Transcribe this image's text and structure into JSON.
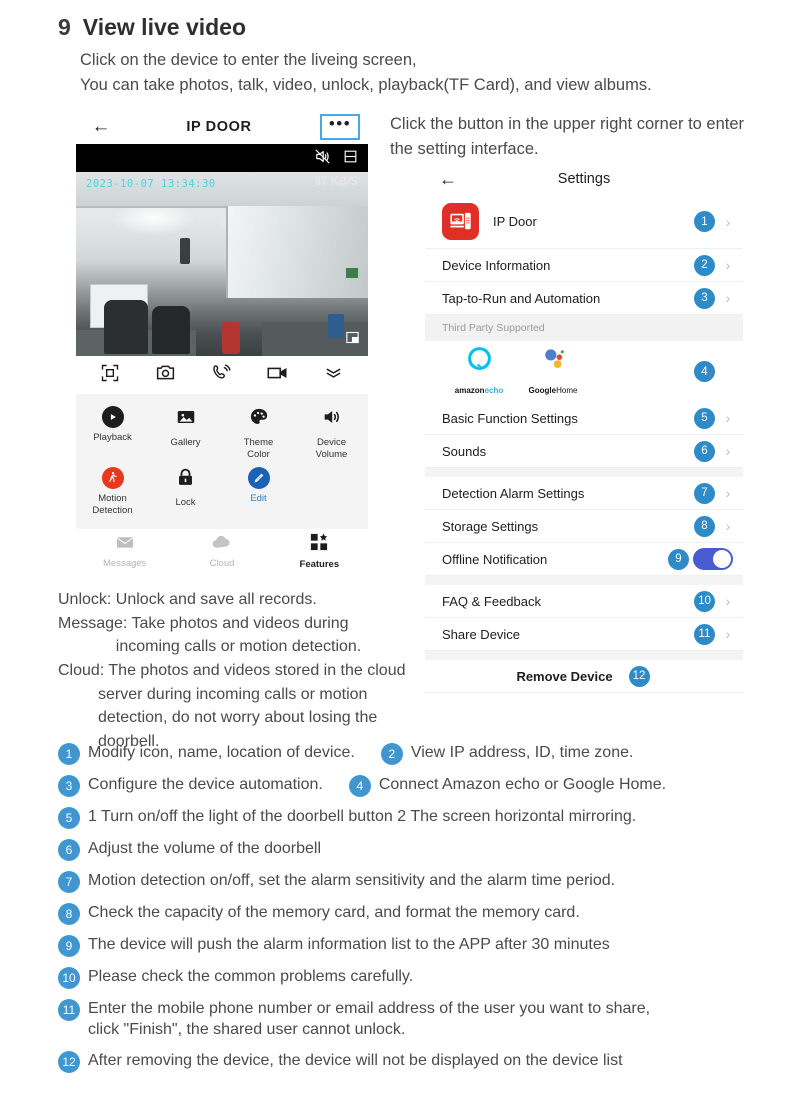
{
  "section": {
    "number": "9",
    "title": "View live video"
  },
  "intro": {
    "line1": "Click on the device to enter the liveing screen,",
    "line2": "You can take photos, talk, video, unlock, playback(TF Card), and view albums."
  },
  "right_note": "Click the button in the upper right corner to enter the setting interface.",
  "phone": {
    "header": {
      "back": "←",
      "title": "IP DOOR",
      "more": "•••"
    },
    "video": {
      "timestamp": "2023-10-07 13:34:30",
      "speed": "37 KB/S"
    },
    "controls": [
      {
        "name": "unlock-icon"
      },
      {
        "name": "photo-icon"
      },
      {
        "name": "talk-icon"
      },
      {
        "name": "record-icon"
      },
      {
        "name": "collapse-icon"
      }
    ],
    "features": [
      {
        "label": "Playback",
        "icon": "play-icon",
        "style": "dark"
      },
      {
        "label": "Gallery",
        "icon": "gallery-icon",
        "style": "plain"
      },
      {
        "label": "Theme\nColor",
        "icon": "palette-icon",
        "style": "plain"
      },
      {
        "label": "Device\nVolume",
        "icon": "volume-icon",
        "style": "plain"
      },
      {
        "label": "Motion\nDetection",
        "icon": "motion-icon",
        "style": "red"
      },
      {
        "label": "Lock",
        "icon": "lock-icon",
        "style": "plain"
      },
      {
        "label": "Edit",
        "icon": "edit-icon",
        "style": "blue"
      }
    ],
    "tabs": [
      {
        "label": "Messages",
        "icon": "mail-icon",
        "active": false
      },
      {
        "label": "Cloud",
        "icon": "cloud-icon",
        "active": false
      },
      {
        "label": "Features",
        "icon": "grid-icon",
        "active": true
      }
    ]
  },
  "settings": {
    "header": {
      "back": "←",
      "title": "Settings"
    },
    "device": {
      "name": "IP Door",
      "badge": "1"
    },
    "rows": [
      {
        "label": "Device Information",
        "badge": "2",
        "chevron": true
      },
      {
        "label": "Tap-to-Run and Automation",
        "badge": "3",
        "chevron": true
      }
    ],
    "third_party": {
      "header": "Third Party Supported",
      "badge": "4",
      "brands": [
        {
          "name_a": "amazon",
          "name_b": "echo",
          "icon": "amazon-echo-icon"
        },
        {
          "name_a": "Google",
          "name_b": "Home",
          "icon": "google-home-icon"
        }
      ]
    },
    "rows2": [
      {
        "label": "Basic Function Settings",
        "badge": "5",
        "chevron": true
      },
      {
        "label": "Sounds",
        "badge": "6",
        "chevron": true
      },
      {
        "label": "Detection Alarm Settings",
        "badge": "7",
        "chevron": true
      },
      {
        "label": "Storage Settings",
        "badge": "8",
        "chevron": true
      }
    ],
    "offline": {
      "label": "Offline Notification",
      "badge": "9",
      "toggle_on": true
    },
    "rows3": [
      {
        "label": "FAQ & Feedback",
        "badge": "10",
        "chevron": true
      },
      {
        "label": "Share Device",
        "badge": "11",
        "chevron": true
      }
    ],
    "remove": {
      "label": "Remove Device",
      "badge": "12"
    }
  },
  "description": "Unlock: Unlock and save all records.\nMessage: Take photos and videos during\n             incoming calls or motion detection.\nCloud: The photos and videos stored in the cloud\n         server during incoming calls or motion\n         detection, do not worry about losing the\n         doorbell.",
  "legend": [
    {
      "num": "1",
      "text": "Modify icon, name, location of device.",
      "num2": "2",
      "text2": "View IP address, ID, time zone."
    },
    {
      "num": "3",
      "text": "Configure the device automation.",
      "num2": "4",
      "text2": "Connect Amazon echo or Google Home."
    },
    {
      "num": "5",
      "text": "1  Turn on/off the light of the doorbell button  2  The screen horizontal mirroring."
    },
    {
      "num": "6",
      "text": "Adjust the volume of the doorbell"
    },
    {
      "num": "7",
      "text": "Motion detection on/off, set the alarm sensitivity and the alarm time period."
    },
    {
      "num": "8",
      "text": "Check the capacity of the memory card, and format the memory card."
    },
    {
      "num": "9",
      "text": "The device will push the alarm information list to the APP after 30 minutes"
    },
    {
      "num": "10",
      "text": "Please check the common problems carefully."
    },
    {
      "num": "11",
      "text": "Enter the mobile phone number or email address of the user you want to share,\nclick \"Finish\", the shared user cannot unlock."
    },
    {
      "num": "12",
      "text": "After removing the device, the device will not be displayed on the device list"
    }
  ],
  "colors": {
    "badge_blue": "#2e8bc8",
    "legend_blue": "#3f96d1",
    "device_red": "#e02f26",
    "toggle_on": "#4a5bd0",
    "accent_link": "#2a7fc4"
  }
}
